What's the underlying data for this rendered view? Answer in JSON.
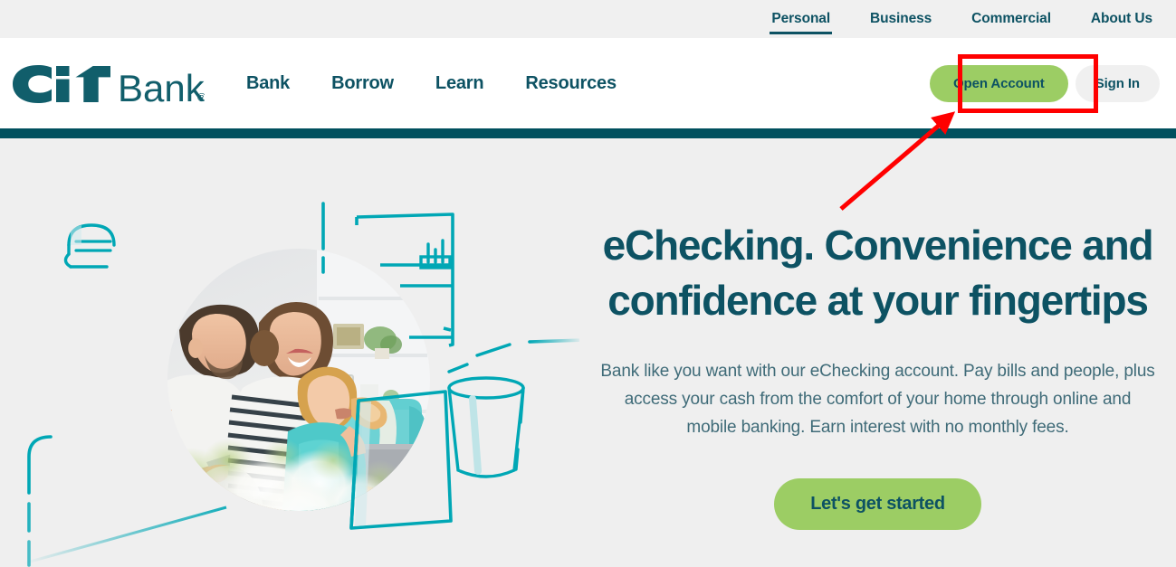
{
  "utility_nav": {
    "items": [
      {
        "label": "Personal",
        "active": true
      },
      {
        "label": "Business",
        "active": false
      },
      {
        "label": "Commercial",
        "active": false
      },
      {
        "label": "About Us",
        "active": false
      }
    ]
  },
  "brand": {
    "mark": "CiT",
    "word": "Bank",
    "trademark": "®",
    "color": "#115e6b"
  },
  "main_nav": {
    "items": [
      {
        "label": "Bank"
      },
      {
        "label": "Borrow"
      },
      {
        "label": "Learn"
      },
      {
        "label": "Resources"
      }
    ]
  },
  "header_actions": {
    "open_account_label": "Open Account",
    "sign_in_label": "Sign In"
  },
  "hero": {
    "title": "eChecking. Convenience and confidence at your fingertips",
    "subtitle": "Bank like you want with our eChecking account. Pay bills and people, plus access your cash from the comfort of your home through online and mobile banking. Earn interest with no monthly fees.",
    "cta_label": "Let's get started",
    "background": "#efefef",
    "illustration_alt": "Family of three with laptop and smartphone in a living room, circular photo with teal line-art of a pendant lamp, shelving, table and drinking glass"
  },
  "annotation": {
    "highlight_target": "open-account-button",
    "box_color": "#ff0000",
    "arrow_color": "#ff0000"
  },
  "colors": {
    "teal_dark": "#0d5263",
    "teal_rule": "#00505e",
    "teal_line_art": "#00a7b5",
    "green_cta": "#9ccd64",
    "gray_bar": "#f0f0f0",
    "hero_bg": "#efefef",
    "body_text": "#3f6b78"
  }
}
